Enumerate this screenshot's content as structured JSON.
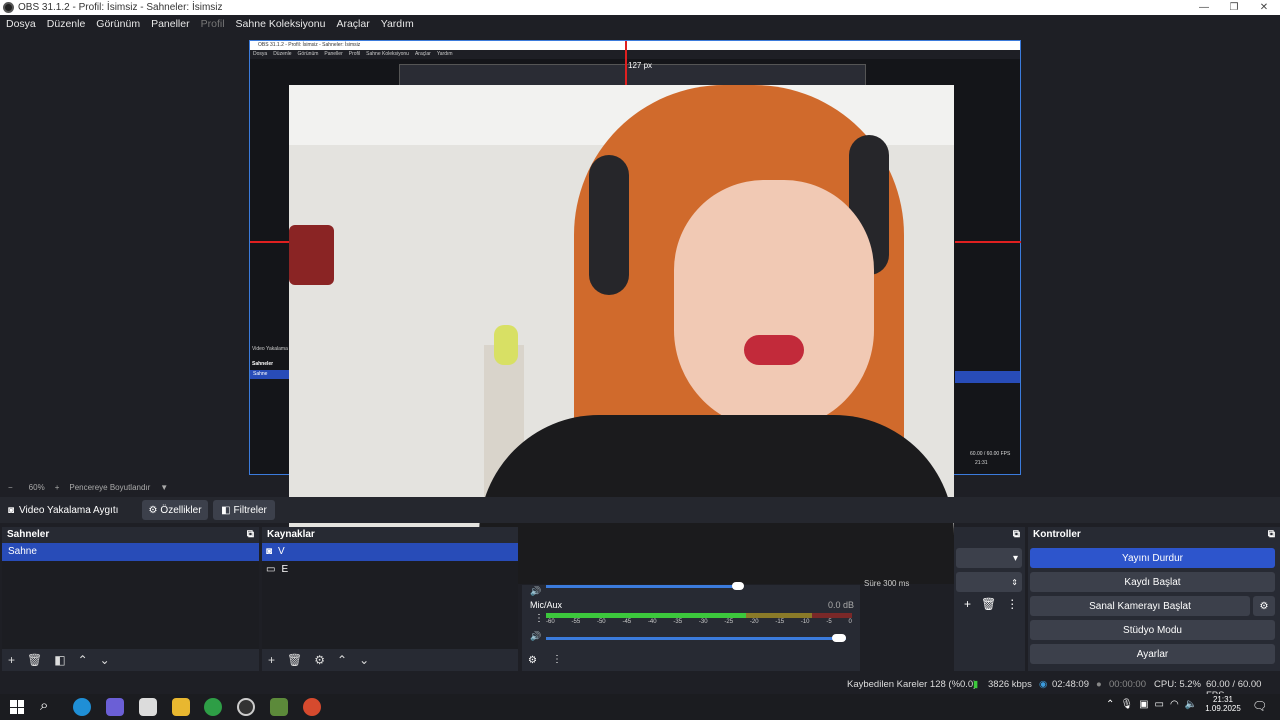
{
  "window": {
    "title": "OBS 31.1.2 - Profil: İsimsiz - Sahneler: İsimsiz"
  },
  "menu": [
    "Dosya",
    "Düzenle",
    "Görünüm",
    "Paneller",
    "Profil",
    "Sahne Koleksiyonu",
    "Araçlar",
    "Yardım"
  ],
  "preview": {
    "nested_title": "OBS 31.1.2 - Profil: İsimsiz - Sahneler: İsimsiz",
    "nested_menu": [
      "Dosya",
      "Düzenle",
      "Görünüm",
      "Paneller",
      "Profil",
      "Sahne Koleksiyonu",
      "Araçlar",
      "Yardım"
    ],
    "distance_label": "127 px",
    "nested_scenes_header": "Sahneler",
    "nested_scene": "Sahne",
    "nested_source": "Video Yakalama",
    "nested_fps": "60.00 / 60.00 FPS",
    "nested_clock": "21:31"
  },
  "zoom": {
    "minus": "−",
    "value": "60%",
    "plus": "+",
    "fit_label": "Pencereye Boyutlandır"
  },
  "source_bar": {
    "source_name": "Video Yakalama Aygıtı",
    "properties_label": "Özellikler",
    "filters_label": "Filtreler"
  },
  "scenes": {
    "header": "Sahneler",
    "items": [
      "Sahne"
    ]
  },
  "sources": {
    "header": "Kaynaklar",
    "items": [
      "V",
      "E"
    ]
  },
  "mixer": {
    "channel": "Mic/Aux",
    "level": "0.0 dB",
    "ticks": [
      "-60",
      "-55",
      "-50",
      "-45",
      "-40",
      "-35",
      "-30",
      "-25",
      "-20",
      "-15",
      "-10",
      "-5",
      "0"
    ],
    "volume": 1.0
  },
  "transitions": {
    "duration_label": "Süre",
    "duration_value": "300 ms"
  },
  "controls": {
    "header": "Kontroller",
    "stop_stream": "Yayını Durdur",
    "start_record": "Kaydı Başlat",
    "start_vcam": "Sanal Kamerayı Başlat",
    "studio_mode": "Stüdyo Modu",
    "settings": "Ayarlar"
  },
  "status": {
    "dropped": "Kaybedilen Kareler 128 (%0.0)",
    "bitrate": "3826 kbps",
    "stream_time": "02:48:09",
    "record_time": "00:00:00",
    "cpu": "CPU: 5.2%",
    "fps": "60.00 / 60.00 FPS"
  },
  "taskbar": {
    "time": "21:31",
    "date": "1.09.2025"
  },
  "colors": {
    "accent": "#284cb8",
    "primary_button": "#2d55cc",
    "meter_green": "#3cc83c",
    "meter_yellow": "#c8b43c",
    "meter_red": "#c83c3c",
    "guide_red": "#e02020"
  }
}
